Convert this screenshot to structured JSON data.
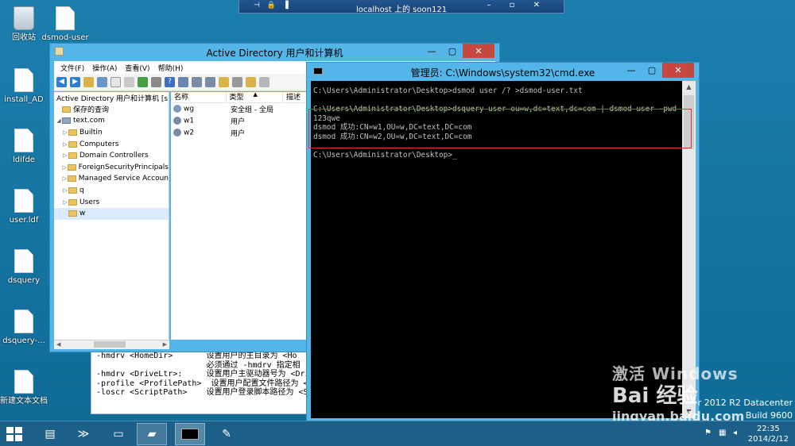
{
  "remote_bar": {
    "title": "localhost 上的 soon121"
  },
  "desktop_icons": [
    {
      "label": "回收站",
      "kind": "recycle-bin"
    },
    {
      "label": "dsmod-user",
      "kind": "file"
    },
    {
      "label": "install_AD",
      "kind": "file"
    },
    {
      "label": "ldifde",
      "kind": "file"
    },
    {
      "label": "user.ldf",
      "kind": "file"
    },
    {
      "label": "dsquery",
      "kind": "file"
    },
    {
      "label": "dsquery-...",
      "kind": "file"
    },
    {
      "label": "新建文本文档",
      "kind": "file"
    }
  ],
  "ad_window": {
    "title": "Active Directory 用户和计算机",
    "menu": [
      "文件(F)",
      "操作(A)",
      "查看(V)",
      "帮助(H)"
    ],
    "tree_root": "Active Directory 用户和计算机 [s",
    "tree": [
      {
        "label": "保存的查询",
        "expander": ""
      },
      {
        "label": "text.com",
        "expander": "◢"
      },
      {
        "label": "Builtin",
        "expander": "▷"
      },
      {
        "label": "Computers",
        "expander": "▷"
      },
      {
        "label": "Domain Controllers",
        "expander": "▷"
      },
      {
        "label": "ForeignSecurityPrincipals",
        "expander": "▷"
      },
      {
        "label": "Managed Service Accoun",
        "expander": "▷"
      },
      {
        "label": "q",
        "expander": "▷"
      },
      {
        "label": "Users",
        "expander": "▷"
      },
      {
        "label": "w",
        "expander": ""
      }
    ],
    "columns": [
      "名称",
      "类型",
      "描述"
    ],
    "rows": [
      {
        "name": "wg",
        "type": "安全组 - 全局"
      },
      {
        "name": "w1",
        "type": "用户"
      },
      {
        "name": "w2",
        "type": "用户"
      }
    ]
  },
  "bg_console": {
    "lines": [
      "-hmdrv <HomeDir>       设置用户的主目录为 <Ho",
      "                       必须通过 -hmdrv 指定相",
      "-hmdrv <DriveLtr>:     设置用户主驱动器号为 <Driv",
      "-profile <ProfilePath>  设置用户配置文件路径为 <P",
      "-loscr <ScriptPath>    设置用户登录脚本路径为 <S"
    ]
  },
  "cmd_window": {
    "title": "管理员: C:\\Windows\\system32\\cmd.exe",
    "lines": [
      "C:\\Users\\Administrator\\Desktop>dsmod user /? >dsmod-user.txt",
      "",
      "C:\\Users\\Administrator\\Desktop>dsquery user ou=w,dc=text,dc=com | dsmod user -pwd 123qwe",
      "dsmod 成功:CN=w1,OU=w,DC=text,DC=com",
      "dsmod 成功:CN=w2,OU=w,DC=text,DC=com",
      "",
      "C:\\Users\\Administrator\\Desktop>_"
    ]
  },
  "watermark": {
    "text1": "激活 Windows",
    "brand": "Bai 经验",
    "url": "jingyan.baidu.com"
  },
  "os_info": {
    "line1": "r 2012 R2 Datacenter",
    "line2": "Build 9600"
  },
  "taskbar": {
    "time": "22:35",
    "date": "2014/2/12"
  }
}
